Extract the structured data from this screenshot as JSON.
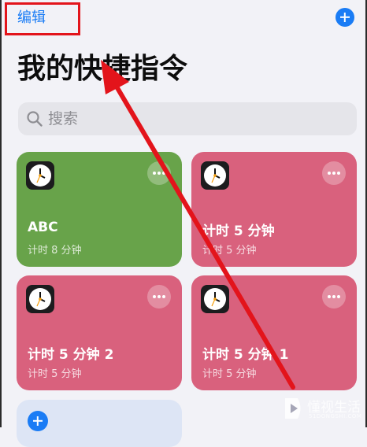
{
  "header": {
    "edit_label": "编辑",
    "add_icon": "plus-icon"
  },
  "title": "我的快捷指令",
  "search": {
    "placeholder": "搜索",
    "icon": "magnifier-icon"
  },
  "shortcuts": [
    {
      "name": "ABC",
      "subtitle": "计时 8 分钟",
      "color": "#68a34a",
      "icon": "clock-icon"
    },
    {
      "name": "计时 5 分钟",
      "subtitle": "计时 5 分钟",
      "color": "#d9617d",
      "icon": "clock-icon"
    },
    {
      "name": "计时 5 分钟 2",
      "subtitle": "计时 5 分钟",
      "color": "#d9617d",
      "icon": "clock-icon"
    },
    {
      "name": "计时 5 分钟 1",
      "subtitle": "计时 5 分钟",
      "color": "#d9617d",
      "icon": "clock-icon"
    }
  ],
  "annotation_color": "#e3141b",
  "accent_color": "#1a7cf5",
  "watermark": {
    "name": "懂视生活",
    "url": "51DONGSHI.COM"
  }
}
